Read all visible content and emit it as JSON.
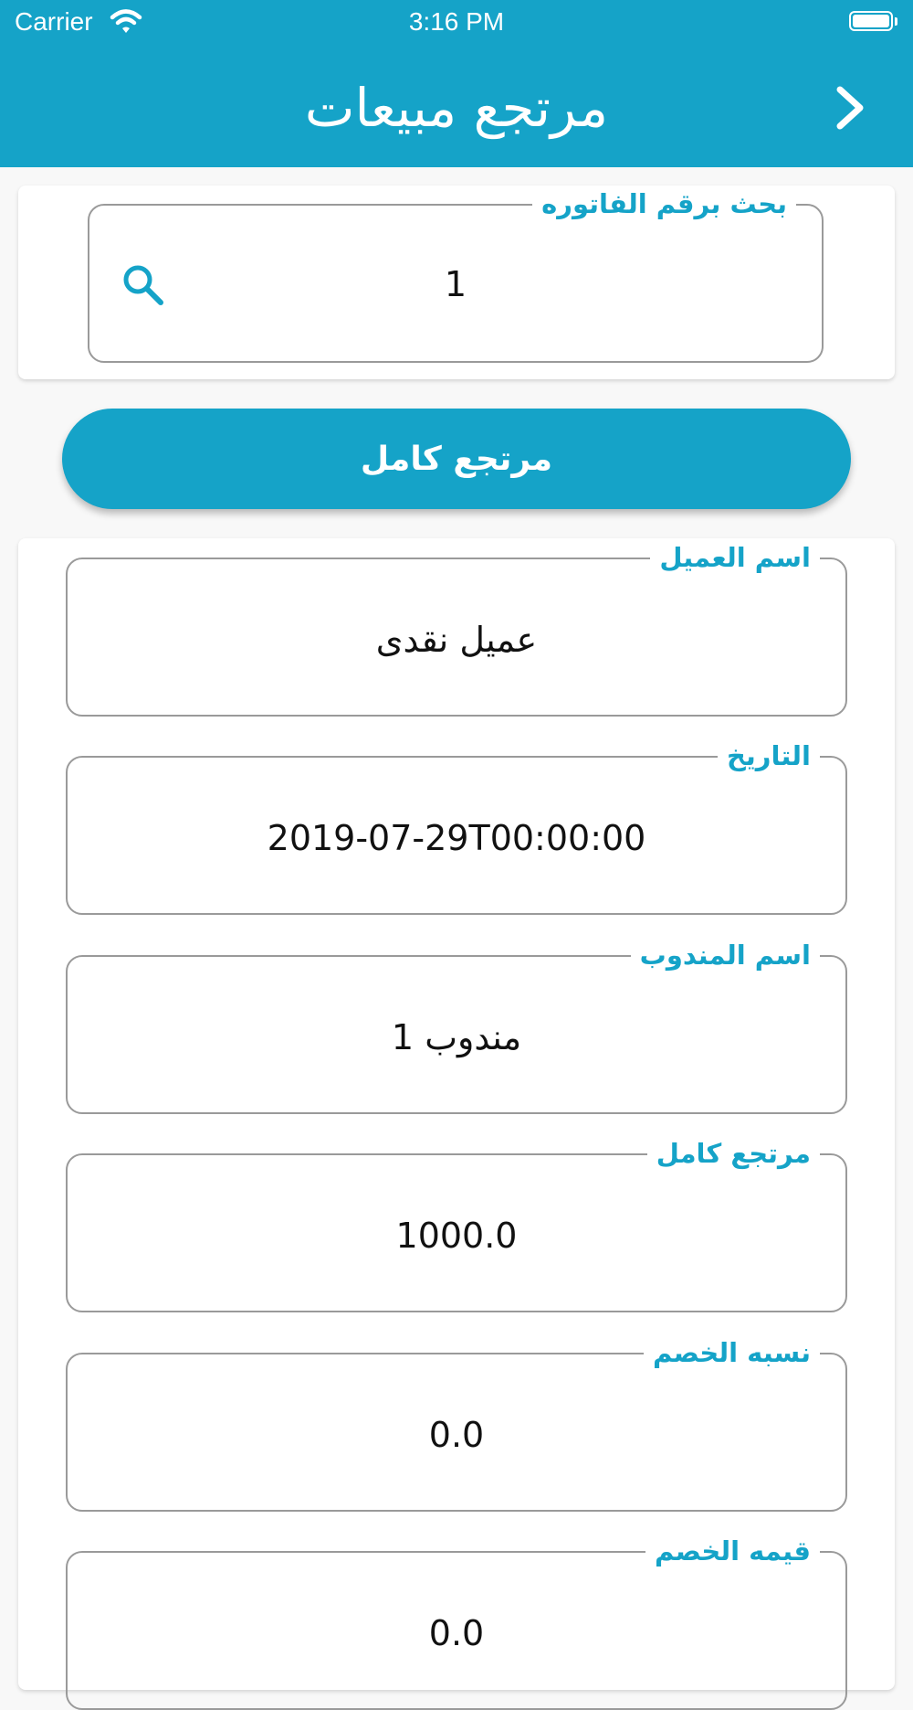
{
  "status_bar": {
    "carrier": "Carrier",
    "time": "3:16 PM"
  },
  "header": {
    "title": "مرتجع مبيعات"
  },
  "search": {
    "label": "بحث برقم الفاتوره",
    "value": "1"
  },
  "actions": {
    "full_return_label": "مرتجع كامل"
  },
  "details": [
    {
      "label": "اسم العميل",
      "value": "عميل نقدى"
    },
    {
      "label": "التاريخ",
      "value": "2019-07-29T00:00:00"
    },
    {
      "label": "اسم المندوب",
      "value": "مندوب 1"
    },
    {
      "label": "مرتجع كامل",
      "value": "1000.0"
    },
    {
      "label": "نسبه الخصم",
      "value": "0.0"
    },
    {
      "label": "قيمه الخصم",
      "value": "0.0"
    }
  ],
  "colors": {
    "accent": "#15a3c8",
    "border": "#9a9a9a",
    "background": "#f8f8f8"
  },
  "icons": {
    "back": "chevron-right-icon",
    "search": "search-icon",
    "wifi": "wifi-icon",
    "battery": "battery-icon"
  }
}
